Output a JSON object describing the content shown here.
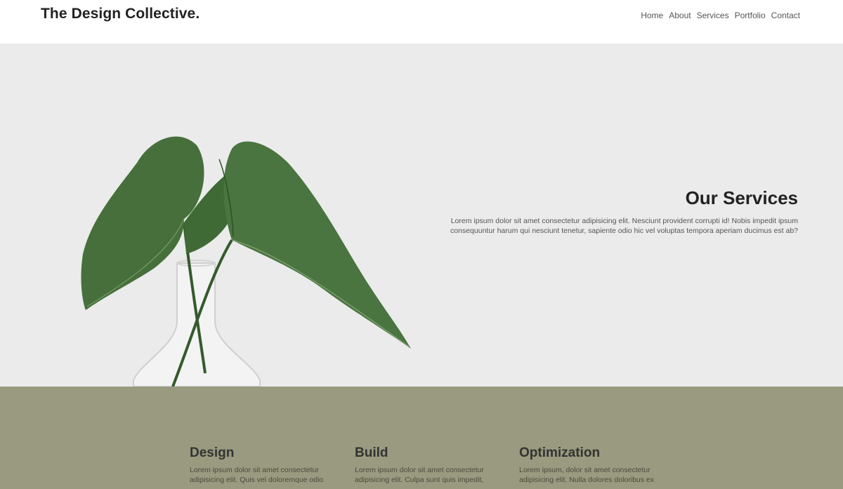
{
  "header": {
    "brand": "The Design Collective.",
    "nav": [
      "Home",
      "About",
      "Services",
      "Portfolio",
      "Contact"
    ]
  },
  "hero": {
    "title": "Our Services",
    "text": "Lorem ipsum dolor sit amet consectetur adipisicing elit. Nesciunt provident corrupti id! Nobis impedit ipsum consequuntur harum qui nesciunt tenetur, sapiente odio hic vel voluptas tempora aperiam ducimus est ab?",
    "image": "plant-in-glass-vase"
  },
  "services": [
    {
      "title": "Design",
      "text": "Lorem ipsum dolor sit amet consectetur adipisicing elit. Quis vel doloremque odio"
    },
    {
      "title": "Build",
      "text": "Lorem ipsum dolor sit amet consectetur adipisicing elit. Culpa sunt quis impedit,"
    },
    {
      "title": "Optimization",
      "text": "Lorem ipsum, dolor sit amet consectetur adipisicing elit. Nulla dolores doloribus ex"
    }
  ],
  "colors": {
    "hero_bg": "#ebebeb",
    "services_bg": "#9a9a80",
    "leaf": "#3f6a35"
  }
}
